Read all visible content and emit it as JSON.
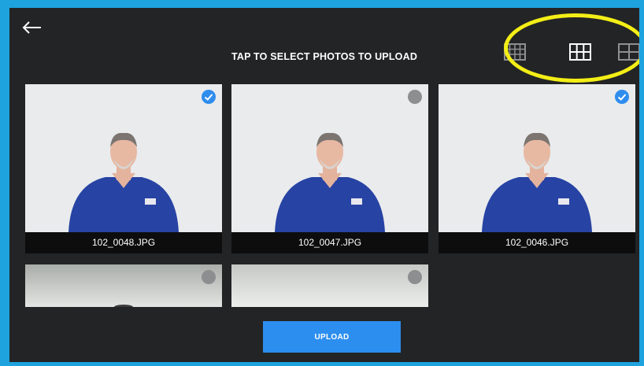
{
  "header": {
    "back_icon": "arrow-left-icon",
    "title": "TAP TO SELECT PHOTOS TO UPLOAD"
  },
  "view_options": [
    {
      "icon": "grid-small-icon",
      "label": "small grid"
    },
    {
      "icon": "grid-medium-icon",
      "label": "medium grid"
    },
    {
      "icon": "grid-large-icon",
      "label": "large grid"
    }
  ],
  "photos": [
    {
      "filename": "102_0048.JPG",
      "selected": true
    },
    {
      "filename": "102_0047.JPG",
      "selected": false
    },
    {
      "filename": "102_0046.JPG",
      "selected": true
    },
    {
      "filename": "",
      "selected": false
    },
    {
      "filename": "",
      "selected": false
    }
  ],
  "actions": {
    "upload_label": "UPLOAD"
  },
  "colors": {
    "accent": "#2c8eef",
    "background": "#232425",
    "border": "#1fa3df",
    "annotation": "#f3ee16"
  }
}
